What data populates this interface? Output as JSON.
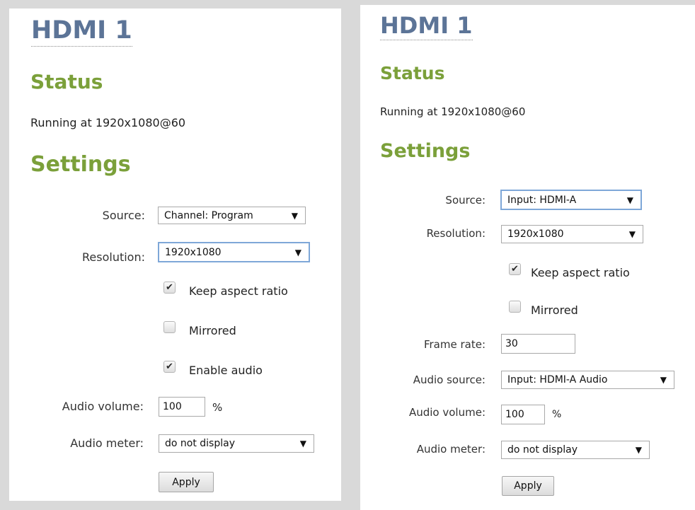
{
  "left": {
    "title": "HDMI 1",
    "status_heading": "Status",
    "status_text": "Running at 1920x1080@60",
    "settings_heading": "Settings",
    "source_label": "Source:",
    "source_value": "Channel: Program",
    "resolution_label": "Resolution:",
    "resolution_value": "1920x1080",
    "keep_aspect_label": "Keep aspect ratio",
    "keep_aspect_checked": true,
    "mirrored_label": "Mirrored",
    "mirrored_checked": false,
    "enable_audio_label": "Enable audio",
    "enable_audio_checked": true,
    "audio_volume_label": "Audio volume:",
    "audio_volume_value": "100",
    "percent_unit": "%",
    "audio_meter_label": "Audio meter:",
    "audio_meter_value": "do not display",
    "apply_label": "Apply"
  },
  "right": {
    "title": "HDMI 1",
    "status_heading": "Status",
    "status_text": "Running at 1920x1080@60",
    "settings_heading": "Settings",
    "source_label": "Source:",
    "source_value": "Input: HDMI-A",
    "resolution_label": "Resolution:",
    "resolution_value": "1920x1080",
    "keep_aspect_label": "Keep aspect ratio",
    "keep_aspect_checked": true,
    "mirrored_label": "Mirrored",
    "mirrored_checked": false,
    "frame_rate_label": "Frame rate:",
    "frame_rate_value": "30",
    "audio_source_label": "Audio source:",
    "audio_source_value": "Input: HDMI-A Audio",
    "audio_volume_label": "Audio volume:",
    "audio_volume_value": "100",
    "percent_unit": "%",
    "audio_meter_label": "Audio meter:",
    "audio_meter_value": "do not display",
    "apply_label": "Apply"
  },
  "icons": {
    "checkmark": "check-icon",
    "dropdown": "triangle-down-icon",
    "check_glyph": "✔",
    "arrow_glyph": "▼"
  },
  "colors": {
    "title": "#5c7497",
    "heading": "#7ba03a",
    "focus_border": "#7ea7d8",
    "background": "#d9d9d9"
  }
}
